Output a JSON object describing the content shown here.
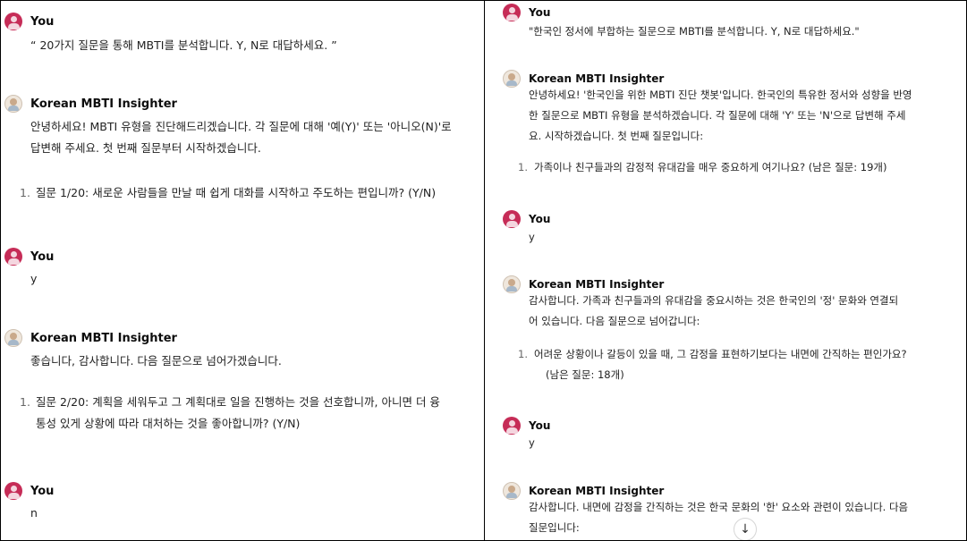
{
  "left": {
    "m1": {
      "author": "You",
      "text": "“ 20가지 질문을 통해 MBTI를 분석합니다. Y, N로 대답하세요. ”"
    },
    "m2": {
      "author": "Korean MBTI Insighter",
      "lines": [
        "안녕하세요! MBTI 유형을 진단해드리겠습니다. 각 질문에 대해 '예(Y)' 또는 '아니오(N)'로",
        "답변해 주세요. 첫 번째 질문부터 시작하겠습니다."
      ],
      "item": {
        "num": "1.",
        "text": "질문 1/20: 새로운 사람들을 만날 때 쉽게 대화를 시작하고 주도하는 편입니까? (Y/N)"
      }
    },
    "m3": {
      "author": "You",
      "text": "y"
    },
    "m4": {
      "author": "Korean MBTI Insighter",
      "lines": [
        "좋습니다, 감사합니다. 다음 질문으로 넘어가겠습니다."
      ],
      "item": {
        "num": "1.",
        "lines": [
          "질문 2/20: 계획을 세워두고 그 계획대로 일을 진행하는 것을 선호합니까, 아니면 더 융",
          "통성 있게 상황에 따라 대처하는 것을 좋아합니까? (Y/N)"
        ]
      }
    },
    "m5": {
      "author": "You",
      "text": "n"
    }
  },
  "right": {
    "m1": {
      "author": "You",
      "text": "\"한국인 정서에 부합하는 질문으로 MBTI를 분석합니다. Y, N로 대답하세요.\""
    },
    "m2": {
      "author": "Korean MBTI Insighter",
      "lines": [
        "안녕하세요! '한국인을 위한 MBTI 진단 챗봇'입니다. 한국인의 특유한 정서와 성향을 반영",
        "한 질문으로 MBTI 유형을 분석하겠습니다. 각 질문에 대해 'Y' 또는 'N'으로 답변해 주세",
        "요. 시작하겠습니다. 첫 번째 질문입니다:"
      ],
      "item": {
        "num": "1.",
        "text": "가족이나 친구들과의 감정적 유대감을 매우 중요하게 여기나요? (남은 질문: 19개)"
      }
    },
    "m3": {
      "author": "You",
      "text": "y"
    },
    "m4": {
      "author": "Korean MBTI Insighter",
      "lines": [
        "감사합니다. 가족과 친구들과의 유대감을 중요시하는 것은 한국인의 '정' 문화와 연결되",
        "어 있습니다. 다음 질문으로 넘어갑니다:"
      ],
      "item": {
        "num": "1.",
        "lines": [
          "어려운 상황이나 갈등이 있을 때, 그 감정을 표현하기보다는 내면에 간직하는 편인가요?",
          "(남은 질문: 18개)"
        ]
      }
    },
    "m5": {
      "author": "You",
      "text": "y"
    },
    "m6": {
      "author": "Korean MBTI Insighter",
      "lines": [
        "감사합니다. 내면에 감정을 간직하는 것은 한국 문화의 '한' 요소와 관련이 있습니다. 다음",
        "질문입니다:"
      ]
    },
    "scroll_icon": "arrow-down-icon",
    "scroll_glyph": "↓"
  },
  "colors": {
    "user_avatar": "#c62c57",
    "text": "#0d0d0d"
  }
}
